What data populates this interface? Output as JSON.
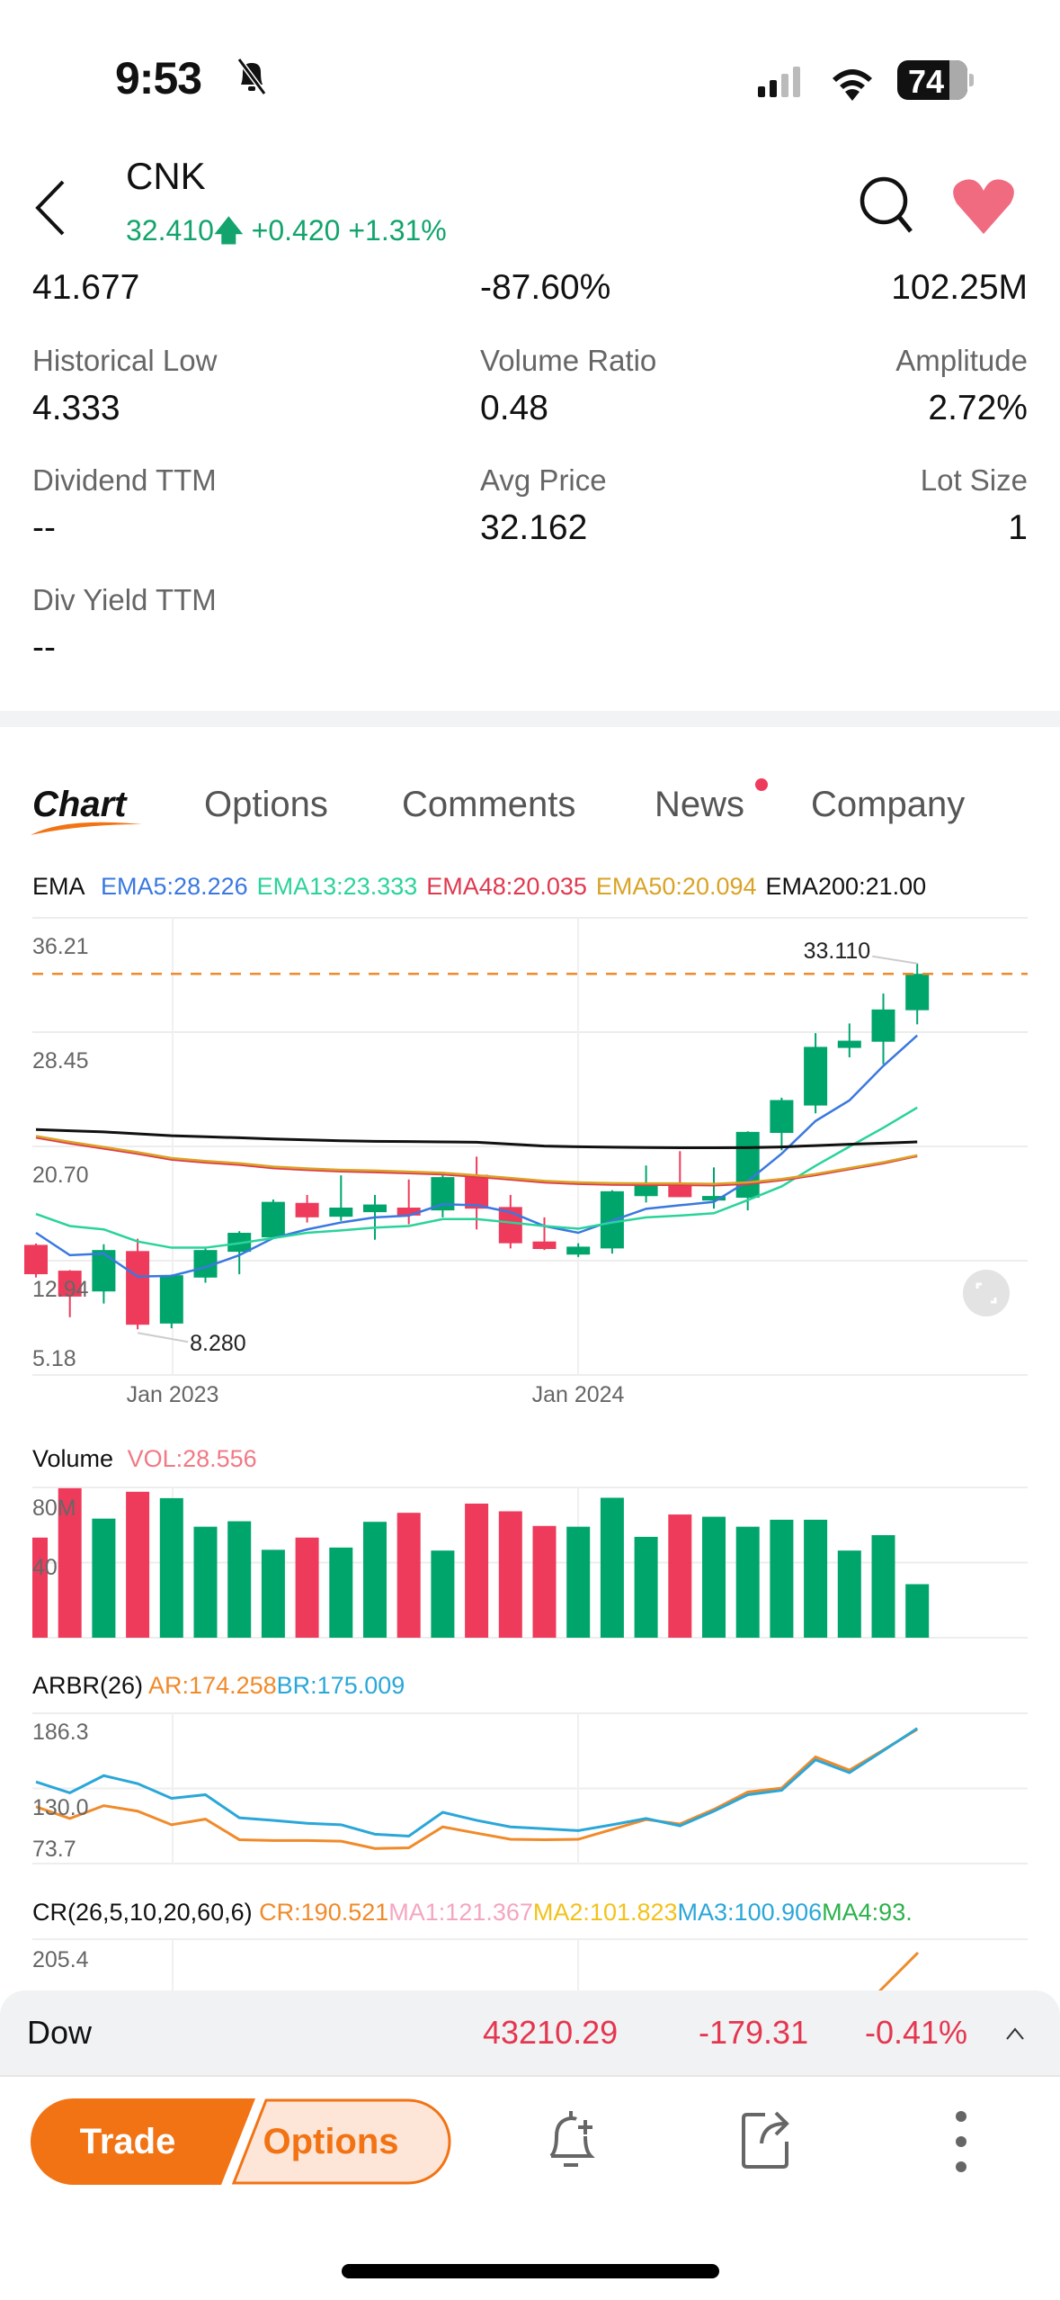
{
  "status_bar": {
    "time": "9:53",
    "battery": "74",
    "icons": [
      "bell-slash-icon",
      "signal-icon",
      "wifi-icon",
      "battery-icon"
    ]
  },
  "header": {
    "symbol": "CNK",
    "price": "32.410",
    "change": "+0.420",
    "change_pct": "+1.31%",
    "up_color": "#13a46d",
    "favorite_color": "#f06a80"
  },
  "stats": [
    {
      "label": "",
      "value": "41.677",
      "align": "left"
    },
    {
      "label": "",
      "value": "-87.60%",
      "align": "left"
    },
    {
      "label": "",
      "value": "102.25M",
      "align": "right"
    },
    {
      "label": "Historical Low",
      "value": "4.333",
      "align": "left"
    },
    {
      "label": "Volume Ratio",
      "value": "0.48",
      "align": "left"
    },
    {
      "label": "Amplitude",
      "value": "2.72%",
      "align": "right"
    },
    {
      "label": "Dividend TTM",
      "value": "--",
      "align": "left"
    },
    {
      "label": "Avg Price",
      "value": "32.162",
      "align": "left"
    },
    {
      "label": "Lot Size",
      "value": "1",
      "align": "right"
    },
    {
      "label": "Div Yield TTM",
      "value": "--",
      "align": "left"
    }
  ],
  "tabs": [
    {
      "label": "Chart",
      "active": true
    },
    {
      "label": "Options"
    },
    {
      "label": "Comments"
    },
    {
      "label": "News",
      "badge": true
    },
    {
      "label": "Company"
    }
  ],
  "chart_data": [
    {
      "type": "candlestick",
      "title": "EMA",
      "period": "monthly",
      "x": [
        "2022-09",
        "2022-10",
        "2022-11",
        "2022-12",
        "2023-01",
        "2023-02",
        "2023-03",
        "2023-04",
        "2023-05",
        "2023-06",
        "2023-07",
        "2023-08",
        "2023-09",
        "2023-10",
        "2023-11",
        "2023-12",
        "2024-01",
        "2024-02",
        "2024-03",
        "2024-04",
        "2024-05",
        "2024-06",
        "2024-07",
        "2024-08",
        "2024-09",
        "2024-10",
        "2024-11"
      ],
      "x_tick_labels": [
        "Jan 2023",
        "Jan 2024"
      ],
      "y_tick_labels": [
        "36.21",
        "28.45",
        "20.70",
        "12.94",
        "5.18"
      ],
      "ylim": [
        5.18,
        36.21
      ],
      "open": [
        14.01,
        12.26,
        10.85,
        13.59,
        8.67,
        11.79,
        13.54,
        14.52,
        16.86,
        15.92,
        16.23,
        16.54,
        16.35,
        18.77,
        16.58,
        14.24,
        13.35,
        13.77,
        17.32,
        18.19,
        17.02,
        17.21,
        21.61,
        23.47,
        27.38,
        27.8,
        29.94
      ],
      "high": [
        14.1,
        12.3,
        14.05,
        14.43,
        12.0,
        13.89,
        14.94,
        17.09,
        17.4,
        18.73,
        17.4,
        18.45,
        18.77,
        20.0,
        17.4,
        15.88,
        14.12,
        17.72,
        19.4,
        20.37,
        19.27,
        21.72,
        24.0,
        28.38,
        29.04,
        31.07,
        33.11
      ],
      "low": [
        11.8,
        9.1,
        10.03,
        8.28,
        8.35,
        11.44,
        12.02,
        14.47,
        15.53,
        15.64,
        14.36,
        15.41,
        15.88,
        15.06,
        13.77,
        13.66,
        13.19,
        13.42,
        16.89,
        17.25,
        16.47,
        16.35,
        20.43,
        22.94,
        26.74,
        26.28,
        28.98
      ],
      "close": [
        12.02,
        10.5,
        13.66,
        8.59,
        11.95,
        13.66,
        14.83,
        16.93,
        15.88,
        16.54,
        16.75,
        16.0,
        18.61,
        16.47,
        14.12,
        13.73,
        13.89,
        17.65,
        18.07,
        17.25,
        17.33,
        21.68,
        23.84,
        27.45,
        27.87,
        29.99,
        32.41
      ],
      "annotations": {
        "high_label": "33.110",
        "low_label": "8.280",
        "current_price": 32.41
      },
      "series": [
        {
          "name": "EMA5",
          "label": "EMA5:28.226",
          "color": "#3a78e0",
          "values": [
            14.83,
            13.31,
            13.42,
            11.86,
            11.91,
            12.49,
            13.31,
            14.47,
            15.06,
            15.53,
            15.88,
            16.0,
            16.77,
            16.7,
            16.23,
            15.29,
            14.83,
            15.65,
            16.46,
            16.7,
            16.93,
            18.33,
            20.2,
            22.42,
            23.82,
            26.16,
            28.23
          ]
        },
        {
          "name": "EMA13",
          "label": "EMA13:23.333",
          "color": "#2ad39b",
          "values": [
            16.11,
            15.29,
            15.06,
            14.24,
            13.82,
            13.82,
            14.12,
            14.47,
            14.83,
            14.99,
            15.18,
            15.29,
            15.76,
            15.76,
            15.53,
            15.29,
            15.11,
            15.53,
            15.88,
            16.0,
            16.16,
            17.05,
            17.98,
            19.38,
            20.68,
            21.96,
            23.33
          ]
        },
        {
          "name": "EMA48",
          "label": "EMA48:20.035",
          "color": "#e0384f",
          "values": [
            21.3,
            20.9,
            20.55,
            20.2,
            19.8,
            19.6,
            19.45,
            19.22,
            19.1,
            19.0,
            18.95,
            18.88,
            18.8,
            18.63,
            18.45,
            18.25,
            18.15,
            18.1,
            18.08,
            18.08,
            18.05,
            18.15,
            18.4,
            18.75,
            19.15,
            19.55,
            20.04
          ]
        },
        {
          "name": "EMA50",
          "label": "EMA50:20.094",
          "color": "#d9a326",
          "values": [
            21.4,
            21.0,
            20.65,
            20.3,
            19.9,
            19.7,
            19.55,
            19.32,
            19.2,
            19.1,
            19.05,
            18.98,
            18.9,
            18.73,
            18.55,
            18.35,
            18.25,
            18.2,
            18.18,
            18.18,
            18.15,
            18.25,
            18.48,
            18.82,
            19.22,
            19.62,
            20.09
          ]
        },
        {
          "name": "EMA200",
          "label": "EMA200:21.00",
          "color": "#111111",
          "values": [
            21.84,
            21.76,
            21.68,
            21.55,
            21.42,
            21.35,
            21.28,
            21.2,
            21.14,
            21.08,
            21.04,
            21.02,
            21.0,
            20.98,
            20.85,
            20.72,
            20.67,
            20.64,
            20.62,
            20.6,
            20.6,
            20.61,
            20.66,
            20.75,
            20.84,
            20.92,
            21.0
          ]
        }
      ]
    },
    {
      "type": "bar",
      "title": "Volume",
      "indicator_label": "VOL:28.556",
      "indicator_color": "#f07a85",
      "y_tick_labels": [
        "80M",
        "40"
      ],
      "ylim": [
        0,
        80
      ],
      "unit": "M",
      "values": [
        53.3,
        79.6,
        63.4,
        77.7,
        74.3,
        59.1,
        62.0,
        46.8,
        53.3,
        48.0,
        61.7,
        66.5,
        46.4,
        71.4,
        67.3,
        59.5,
        59.1,
        74.5,
        53.7,
        65.6,
        64.4,
        59.1,
        62.8,
        62.8,
        46.4,
        54.6,
        28.5
      ]
    },
    {
      "type": "line",
      "title": "ARBR(26)",
      "y_tick_labels": [
        "186.3",
        "130.0",
        "73.7"
      ],
      "ylim": [
        73.7,
        186.3
      ],
      "series": [
        {
          "name": "AR",
          "label": "AR:174.258",
          "color": "#f08a2a",
          "values": [
            116.3,
            107.5,
            117.1,
            113.0,
            102.8,
            107.0,
            91.6,
            91.0,
            91.0,
            90.5,
            85.0,
            85.5,
            101.2,
            96.5,
            91.9,
            91.6,
            91.9,
            99.3,
            106.7,
            103.4,
            114.3,
            127.3,
            130.3,
            153.6,
            143.7,
            158.8,
            174.3
          ]
        },
        {
          "name": "BR",
          "label": "BR:175.009",
          "color": "#2aa7d8",
          "values": [
            134.9,
            126.7,
            139.6,
            133.6,
            122.6,
            125.3,
            108.0,
            106.1,
            103.9,
            102.8,
            95.7,
            94.3,
            112.1,
            106.1,
            101.2,
            99.8,
            98.4,
            102.8,
            107.5,
            102.0,
            113.0,
            125.3,
            128.6,
            151.4,
            141.8,
            158.3,
            175.0
          ]
        }
      ]
    },
    {
      "type": "line",
      "title": "CR(26,5,10,20,60,6)",
      "y_tick_labels": [
        "205.4"
      ],
      "series": [
        {
          "name": "CR",
          "label": "CR:190.521",
          "color": "#f08a2a"
        },
        {
          "name": "MA1",
          "label": "MA1:121.367",
          "color": "#f4a6c0"
        },
        {
          "name": "MA2",
          "label": "MA2:101.823",
          "color": "#f2c21b"
        },
        {
          "name": "MA3",
          "label": "MA3:100.906",
          "color": "#2aa7d8"
        },
        {
          "name": "MA4",
          "label": "MA4:93.",
          "color": "#2cb24a"
        }
      ]
    }
  ],
  "colors": {
    "up": "#00a56c",
    "down": "#ee3b5b",
    "accent": "#f27314"
  },
  "index_bar": {
    "name": "Dow",
    "value": "43210.29",
    "change": "-179.31",
    "change_pct": "-0.41%",
    "color": "#e5364f"
  },
  "bottom_bar": {
    "trade_label": "Trade",
    "options_label": "Options",
    "icons": [
      "bell-plus-icon",
      "share-icon",
      "more-icon"
    ]
  }
}
